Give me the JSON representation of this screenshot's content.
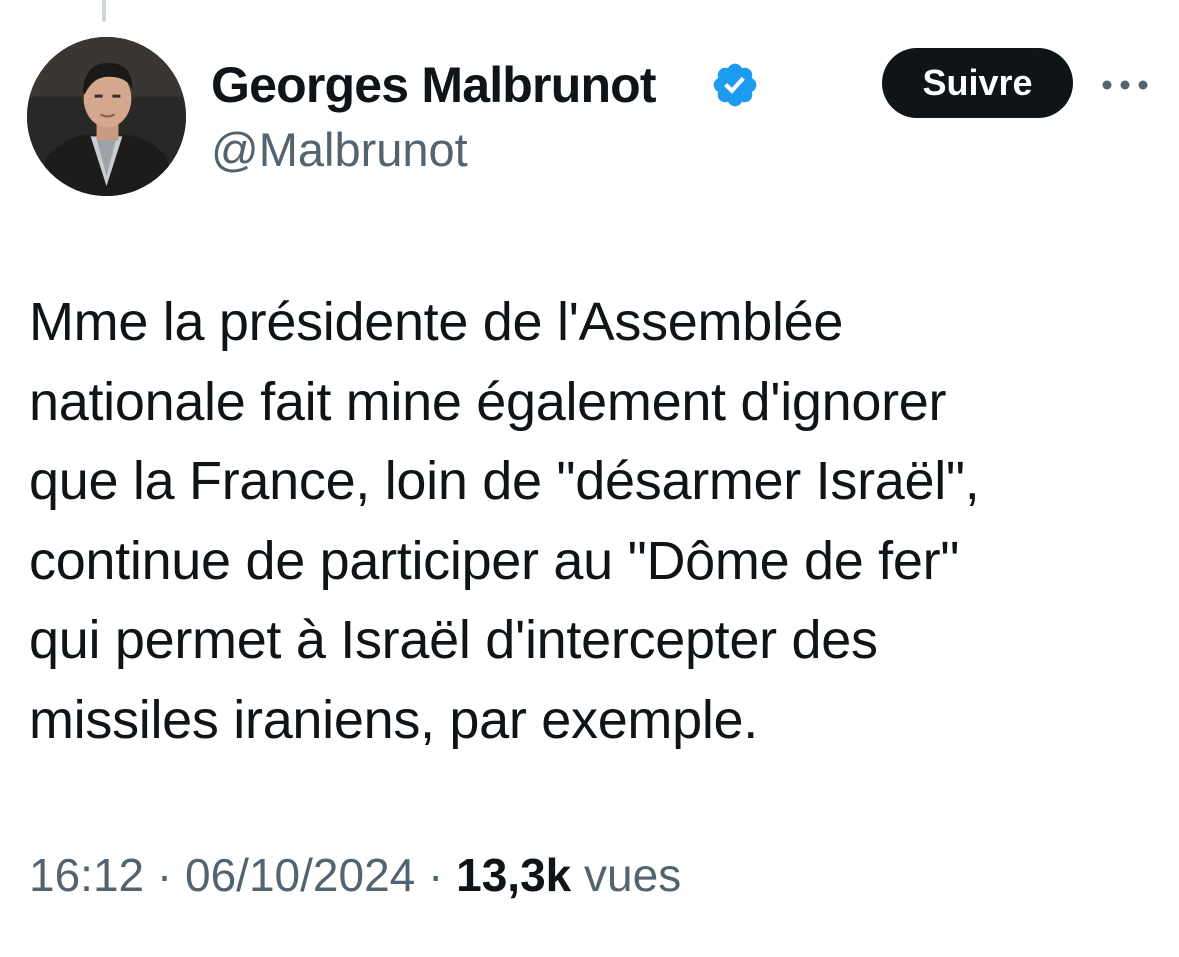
{
  "author": {
    "display_name": "Georges Malbrunot",
    "handle": "@Malbrunot",
    "verified": true
  },
  "actions": {
    "follow_label": "Suivre",
    "more_icon": "more-horizontal-icon"
  },
  "tweet": {
    "lines": [
      "Mme la présidente de l'Assemblée",
      "nationale fait mine également d'ignorer",
      "que la France, loin de \"désarmer Israël\",",
      "continue de participer au \"Dôme de fer\"",
      "qui permet à Israël d'intercepter des",
      "missiles iraniens, par exemple."
    ]
  },
  "meta": {
    "time": "16:12",
    "separator": "·",
    "date": "06/10/2024",
    "views_count": "13,3k",
    "views_label": "vues"
  },
  "colors": {
    "text_primary": "#0f1419",
    "text_secondary": "#536471",
    "verified_blue": "#1d9bf0",
    "button_bg": "#0f1419"
  }
}
